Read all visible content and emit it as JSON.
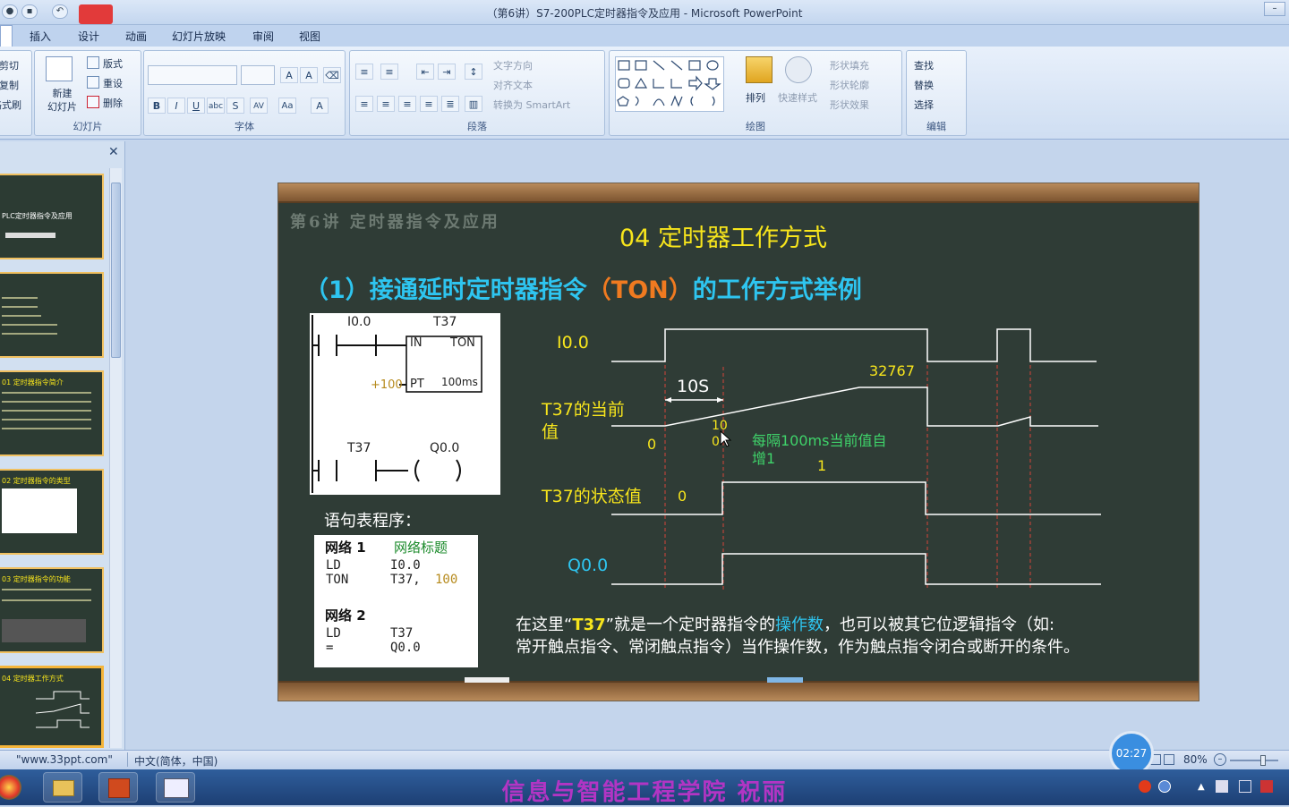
{
  "window": {
    "title": "（第6讲）S7-200PLC定时器指令及应用 - Microsoft PowerPoint"
  },
  "tabs": [
    "插入",
    "设计",
    "动画",
    "幻灯片放映",
    "审阅",
    "视图"
  ],
  "ribbon": {
    "clipboard_partial": [
      "剪切",
      "复制",
      "格式刷"
    ],
    "slides_group": {
      "new_slide": "新建\n幻灯片",
      "layout": "版式",
      "reset": "重设",
      "delete": "删除",
      "label": "幻灯片"
    },
    "font_group": {
      "label": "字体"
    },
    "paragraph_group": {
      "text_direction": "文字方向",
      "align_text": "对齐文本",
      "smartart": "转换为 SmartArt",
      "label": "段落"
    },
    "drawing_group": {
      "arrange": "排列",
      "quick_styles": "快速样式",
      "shape_fill": "形状填充",
      "shape_outline": "形状轮廓",
      "shape_effects": "形状效果",
      "label": "绘图"
    },
    "editing_group": {
      "find": "查找",
      "replace": "替换",
      "select": "选择",
      "label": "编辑"
    }
  },
  "thumbnails": [
    {
      "caption": "PLC定时器指令及应用"
    },
    {
      "caption": ""
    },
    {
      "caption": "01 定时器指令简介"
    },
    {
      "caption": "02 定时器指令的类型"
    },
    {
      "caption": "03 定时器指令的功能"
    },
    {
      "caption": "04 定时器工作方式"
    }
  ],
  "slide": {
    "chalk_header": "第6讲 定时器指令及应用",
    "title": "04 定时器工作方式",
    "subtitle_a": "（1）接通延时定时器指令",
    "subtitle_b": "（TON）",
    "subtitle_c": "的工作方式举例",
    "ladder": {
      "c1": "I0.0",
      "t37": "T37",
      "in": "IN",
      "ton": "TON",
      "pt_val": "+100",
      "pt": "PT",
      "base": "100ms",
      "c2": "T37",
      "coil": "Q0.0"
    },
    "stl_title": "语句表程序：",
    "stl": {
      "net1": "网络 1",
      "net1_title": "网络标题",
      "l1a": "LD",
      "l1b": "I0.0",
      "l2a": "TON",
      "l2b": "T37,",
      "l2c": "100",
      "net2": "网络 2",
      "l3a": "LD",
      "l3b": "T37",
      "l4a": "=",
      "l4b": "Q0.0"
    },
    "timing": {
      "i00": "I0.0",
      "t37_cur": "T37的当前",
      "t37_cur2": "值",
      "t37_state": "T37的状态值",
      "q00": "Q0.0",
      "ten_s": "10S",
      "max": "32767",
      "zero1": "0",
      "ten": "10",
      "zero2": "0",
      "note": "每隔100ms当前值自",
      "note2": "增1",
      "one": "1",
      "zero3": "0"
    },
    "para_1a": "在这里“",
    "para_1b": "T37",
    "para_1c": "”就是一个定时器指令的",
    "para_1d": "操作数",
    "para_1e": "，也可以被其它位逻辑指令（如:",
    "para_2": "常开触点指令、常闭触点指令）当作操作数，作为触点指令闭合或断开的条件。"
  },
  "statusbar": {
    "theme": "\"www.33ppt.com\"",
    "lang": "中文(简体，中国)",
    "zoom": "80%"
  },
  "timer": "02:27",
  "watermark": "信息与智能工程学院 祝丽",
  "colors": {
    "title_yellow": "#f7e51c",
    "cyan": "#2ec5f0",
    "orange": "#f07a20",
    "green": "#3fd36a",
    "red_dash": "#d6443a"
  }
}
